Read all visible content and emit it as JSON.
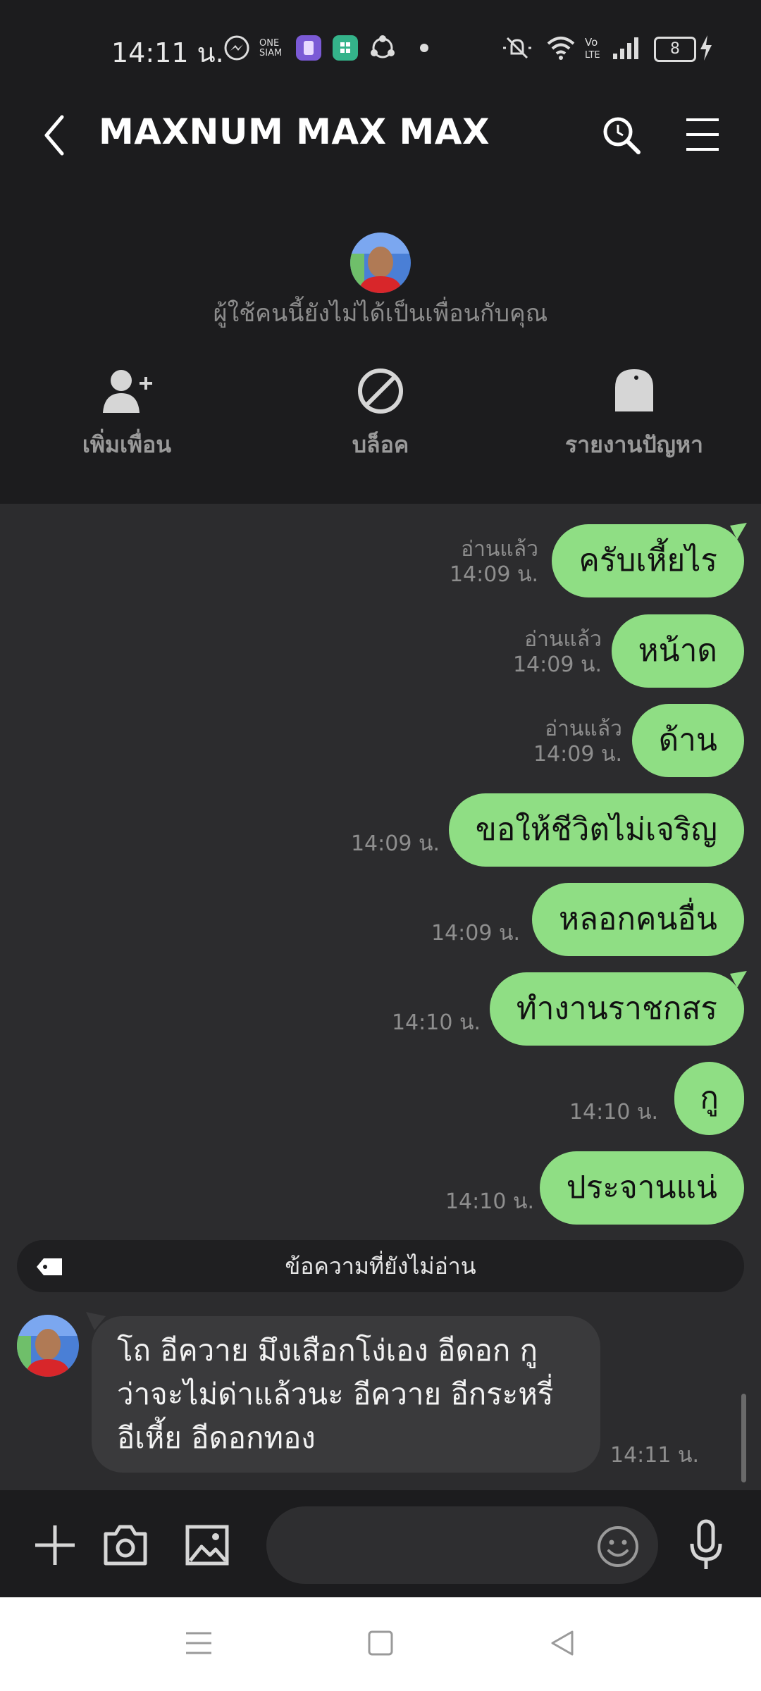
{
  "status_bar": {
    "time": "14:11 น.",
    "battery": "8",
    "icons": [
      "messenger-icon",
      "onesiam-icon",
      "app-icon",
      "app-icon",
      "share-icon",
      "dot-icon",
      "mute-icon",
      "wifi-icon",
      "volte-icon",
      "signal-icon",
      "battery-icon",
      "charging-icon"
    ]
  },
  "header": {
    "title": "MAXNUM MAX MAX"
  },
  "profile": {
    "not_friend_text": "ผู้ใช้คนนี้ยังไม่ได้เป็นเพื่อนกับคุณ",
    "actions": [
      {
        "label": "เพิ่มเพื่อน",
        "icon": "add-friend-icon"
      },
      {
        "label": "บล็อค",
        "icon": "block-icon"
      },
      {
        "label": "รายงานปัญหา",
        "icon": "report-icon"
      }
    ]
  },
  "messages": [
    {
      "text": "ครับเหี้ยไร",
      "read": "อ่านแล้ว",
      "time": "14:09 น."
    },
    {
      "text": "หน้าด",
      "read": "อ่านแล้ว",
      "time": "14:09 น."
    },
    {
      "text": "ด้าน",
      "read": "อ่านแล้ว",
      "time": "14:09 น."
    },
    {
      "text": "ขอให้ชีวิตไม่เจริญ",
      "read": "",
      "time": "14:09 น."
    },
    {
      "text": "หลอกคนอื่น",
      "read": "",
      "time": "14:09 น."
    },
    {
      "text": "ทำงานราชกสร",
      "read": "",
      "time": "14:10 น."
    },
    {
      "text": "กู",
      "read": "",
      "time": "14:10 น."
    },
    {
      "text": "ประจานแน่",
      "read": "",
      "time": "14:10 น."
    }
  ],
  "unread_divider": "ข้อความที่ยังไม่อ่าน",
  "incoming": {
    "line1": "โถ อีควาย มึงเสือกโง่เอง อีดอก กู",
    "line2": "ว่าจะไม่ด่าแล้วนะ อีควาย อีกระหรี่",
    "line3": "อีเหี้ย อีดอกทอง",
    "time": "14:11 น."
  },
  "colors": {
    "background": "#1c1c1e",
    "chat_background": "#2c2c2e",
    "outgoing_bubble": "#8fde84",
    "incoming_bubble": "#3a3a3c"
  }
}
